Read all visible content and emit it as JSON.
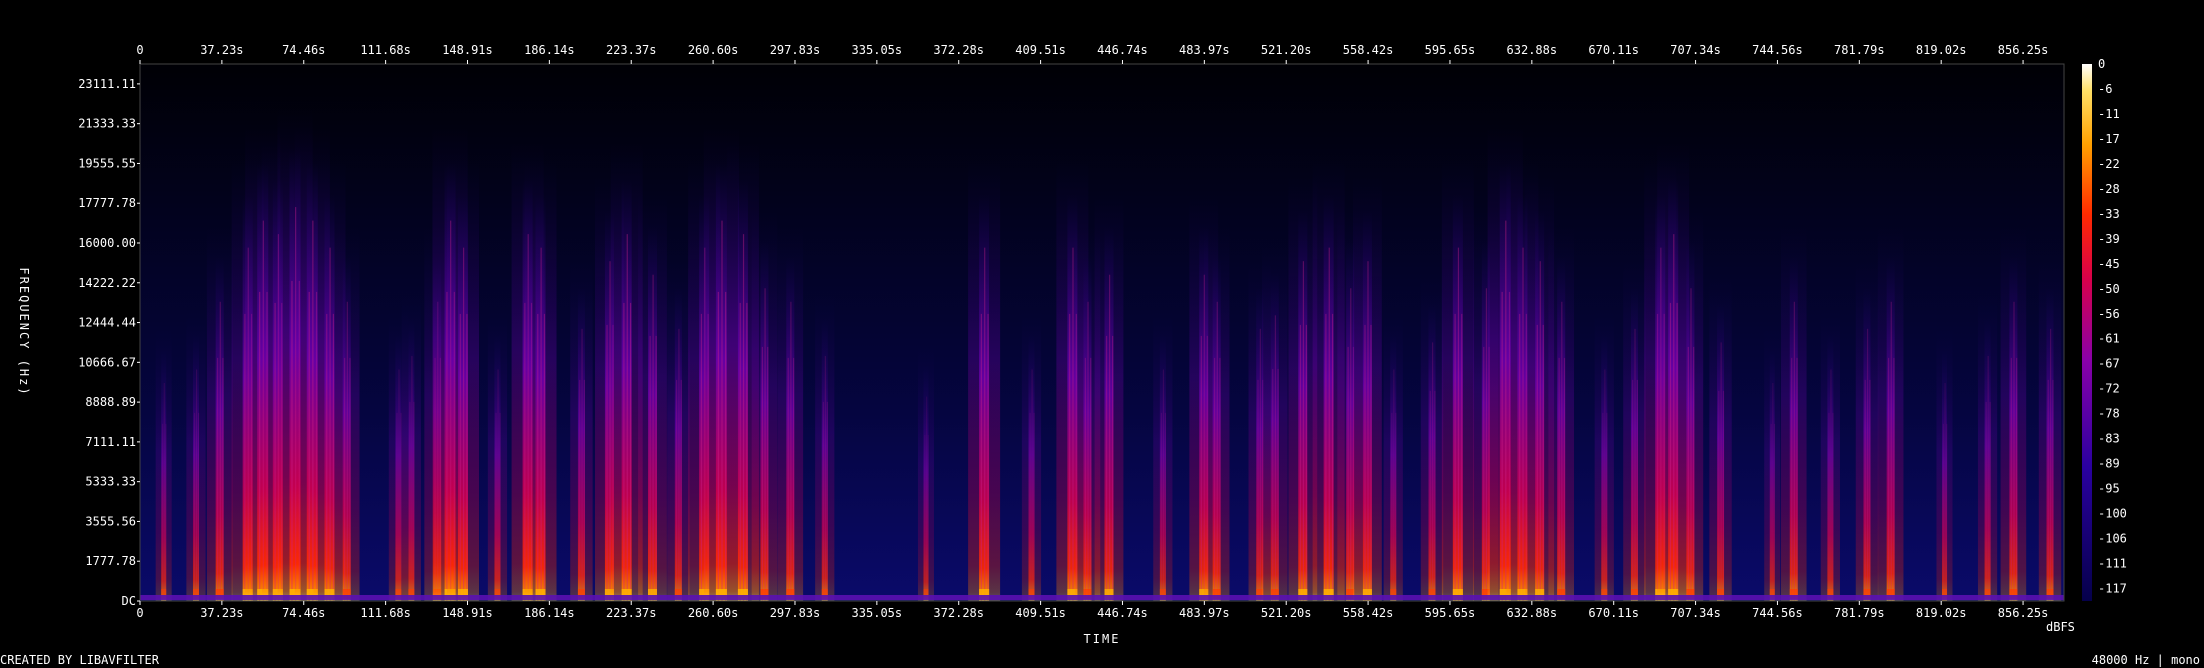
{
  "chart_data": {
    "type": "heatmap",
    "subtype": "spectrogram",
    "xlabel": "TIME",
    "ylabel": "FREQUENCY (Hz)",
    "colorbar_label": "dBFS",
    "x_ticks": [
      "0",
      "37.23s",
      "74.46s",
      "111.68s",
      "148.91s",
      "186.14s",
      "223.37s",
      "260.60s",
      "297.83s",
      "335.05s",
      "372.28s",
      "409.51s",
      "446.74s",
      "483.97s",
      "521.20s",
      "558.42s",
      "595.65s",
      "632.88s",
      "670.11s",
      "707.34s",
      "744.56s",
      "781.79s",
      "819.02s",
      "856.25s"
    ],
    "y_ticks": [
      "DC",
      "1777.78",
      "3555.56",
      "5333.33",
      "7111.11",
      "8888.89",
      "10666.67",
      "12444.44",
      "14222.22",
      "16000.00",
      "17777.78",
      "19555.55",
      "21333.33",
      "23111.11"
    ],
    "xlim": [
      0,
      893.5
    ],
    "ylim": [
      0,
      24000
    ],
    "colorbar_ticks": [
      "0",
      "-6",
      "-11",
      "-17",
      "-22",
      "-28",
      "-33",
      "-39",
      "-45",
      "-50",
      "-56",
      "-61",
      "-67",
      "-72",
      "-78",
      "-83",
      "-89",
      "-95",
      "-100",
      "-106",
      "-111",
      "-117"
    ],
    "colorbar_range": [
      -120,
      0
    ],
    "colors": {
      "low": "#05004a",
      "mid": "#8a00a8",
      "high": "#ff2a00",
      "peak": "#ffe066",
      "background": "#000000"
    },
    "bursts": [
      {
        "t": 11,
        "level": 0.25
      },
      {
        "t": 26,
        "level": 0.3
      },
      {
        "t": 37,
        "level": 0.55
      },
      {
        "t": 50,
        "level": 0.75
      },
      {
        "t": 57,
        "level": 0.85
      },
      {
        "t": 64,
        "level": 0.8
      },
      {
        "t": 72,
        "level": 0.9
      },
      {
        "t": 80,
        "level": 0.85
      },
      {
        "t": 88,
        "level": 0.75
      },
      {
        "t": 96,
        "level": 0.55
      },
      {
        "t": 120,
        "level": 0.3
      },
      {
        "t": 126,
        "level": 0.35
      },
      {
        "t": 138,
        "level": 0.55
      },
      {
        "t": 144,
        "level": 0.85
      },
      {
        "t": 150,
        "level": 0.75
      },
      {
        "t": 166,
        "level": 0.3
      },
      {
        "t": 180,
        "level": 0.8
      },
      {
        "t": 186,
        "level": 0.75
      },
      {
        "t": 205,
        "level": 0.45
      },
      {
        "t": 218,
        "level": 0.7
      },
      {
        "t": 226,
        "level": 0.8
      },
      {
        "t": 238,
        "level": 0.65
      },
      {
        "t": 250,
        "level": 0.45
      },
      {
        "t": 262,
        "level": 0.75
      },
      {
        "t": 270,
        "level": 0.85
      },
      {
        "t": 280,
        "level": 0.8
      },
      {
        "t": 290,
        "level": 0.6
      },
      {
        "t": 302,
        "level": 0.55
      },
      {
        "t": 318,
        "level": 0.35
      },
      {
        "t": 365,
        "level": 0.2
      },
      {
        "t": 392,
        "level": 0.75
      },
      {
        "t": 414,
        "level": 0.3
      },
      {
        "t": 433,
        "level": 0.75
      },
      {
        "t": 440,
        "level": 0.55
      },
      {
        "t": 450,
        "level": 0.65
      },
      {
        "t": 475,
        "level": 0.3
      },
      {
        "t": 494,
        "level": 0.65
      },
      {
        "t": 500,
        "level": 0.55
      },
      {
        "t": 520,
        "level": 0.45
      },
      {
        "t": 527,
        "level": 0.5
      },
      {
        "t": 540,
        "level": 0.7
      },
      {
        "t": 552,
        "level": 0.75
      },
      {
        "t": 562,
        "level": 0.6
      },
      {
        "t": 570,
        "level": 0.7
      },
      {
        "t": 582,
        "level": 0.3
      },
      {
        "t": 600,
        "level": 0.4
      },
      {
        "t": 612,
        "level": 0.75
      },
      {
        "t": 625,
        "level": 0.6
      },
      {
        "t": 634,
        "level": 0.85
      },
      {
        "t": 642,
        "level": 0.75
      },
      {
        "t": 650,
        "level": 0.7
      },
      {
        "t": 660,
        "level": 0.55
      },
      {
        "t": 680,
        "level": 0.3
      },
      {
        "t": 694,
        "level": 0.45
      },
      {
        "t": 706,
        "level": 0.75
      },
      {
        "t": 712,
        "level": 0.8
      },
      {
        "t": 720,
        "level": 0.6
      },
      {
        "t": 734,
        "level": 0.4
      },
      {
        "t": 758,
        "level": 0.25
      },
      {
        "t": 768,
        "level": 0.55
      },
      {
        "t": 785,
        "level": 0.3
      },
      {
        "t": 802,
        "level": 0.45
      },
      {
        "t": 813,
        "level": 0.55
      },
      {
        "t": 838,
        "level": 0.25
      },
      {
        "t": 858,
        "level": 0.35
      },
      {
        "t": 870,
        "level": 0.55
      },
      {
        "t": 887,
        "level": 0.45
      }
    ]
  },
  "footer": {
    "created_by": "CREATED BY LIBAVFILTER",
    "sample_info": "48000 Hz | mono"
  }
}
